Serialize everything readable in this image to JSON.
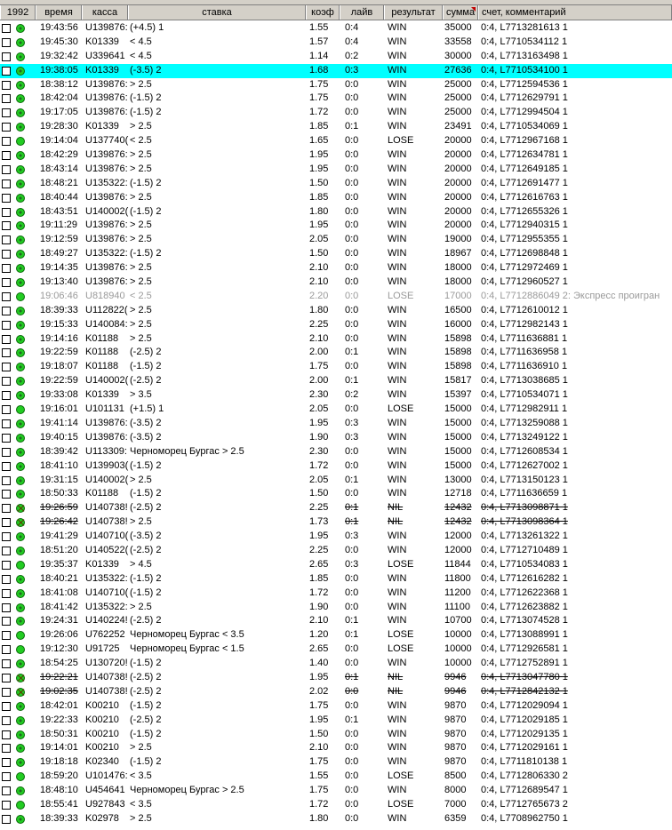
{
  "header": {
    "count": "1992",
    "time": "время",
    "kassa": "касса",
    "bet": "ставка",
    "coef": "коэф",
    "live": "лайв",
    "result": "результат",
    "sum": "сумма",
    "comment": "счет, комментарий"
  },
  "rows": [
    {
      "time": "19:43:56",
      "kassa": "U139876:",
      "bet": "(+4.5) 1",
      "coef": "1.55",
      "live": "0:4",
      "result": "WIN",
      "sum": "35000",
      "comment": "0:4, L7713281613 1",
      "state": "normal",
      "icon": "mixed"
    },
    {
      "time": "19:45:30",
      "kassa": "K01339",
      "bet": "< 4.5",
      "coef": "1.57",
      "live": "0:4",
      "result": "WIN",
      "sum": "33558",
      "comment": "0:4, L7710534112 1",
      "state": "normal",
      "icon": "mixed"
    },
    {
      "time": "19:32:42",
      "kassa": "U339641",
      "bet": "< 4.5",
      "coef": "1.14",
      "live": "0:2",
      "result": "WIN",
      "sum": "30000",
      "comment": "0:4, L7713163498 1",
      "state": "normal",
      "icon": "mixed"
    },
    {
      "time": "19:38:05",
      "kassa": "K01339",
      "bet": "(-3.5) 2",
      "coef": "1.68",
      "live": "0:3",
      "result": "WIN",
      "sum": "27636",
      "comment": "0:4, L7710534100 1",
      "state": "selected",
      "icon": "mixed"
    },
    {
      "time": "18:38:12",
      "kassa": "U139876:",
      "bet": "> 2.5",
      "coef": "1.75",
      "live": "0:0",
      "result": "WIN",
      "sum": "25000",
      "comment": "0:4, L7712594536 1",
      "state": "normal",
      "icon": "mixed"
    },
    {
      "time": "18:42:04",
      "kassa": "U139876:",
      "bet": "(-1.5) 2",
      "coef": "1.75",
      "live": "0:0",
      "result": "WIN",
      "sum": "25000",
      "comment": "0:4, L7712629791 1",
      "state": "normal",
      "icon": "mixed"
    },
    {
      "time": "19:17:05",
      "kassa": "U139876:",
      "bet": "(-1.5) 2",
      "coef": "1.72",
      "live": "0:0",
      "result": "WIN",
      "sum": "25000",
      "comment": "0:4, L7712994504 1",
      "state": "normal",
      "icon": "mixed"
    },
    {
      "time": "19:28:30",
      "kassa": "K01339",
      "bet": "> 2.5",
      "coef": "1.85",
      "live": "0:1",
      "result": "WIN",
      "sum": "23491",
      "comment": "0:4, L7710534069 1",
      "state": "normal",
      "icon": "mixed"
    },
    {
      "time": "19:14:04",
      "kassa": "U137740(",
      "bet": "< 2.5",
      "coef": "1.65",
      "live": "0:0",
      "result": "LOSE",
      "sum": "20000",
      "comment": "0:4, L7712967168 1",
      "state": "normal",
      "icon": "green"
    },
    {
      "time": "18:42:29",
      "kassa": "U139876:",
      "bet": "> 2.5",
      "coef": "1.95",
      "live": "0:0",
      "result": "WIN",
      "sum": "20000",
      "comment": "0:4, L7712634781 1",
      "state": "normal",
      "icon": "mixed"
    },
    {
      "time": "18:43:14",
      "kassa": "U139876:",
      "bet": "> 2.5",
      "coef": "1.95",
      "live": "0:0",
      "result": "WIN",
      "sum": "20000",
      "comment": "0:4, L7712649185 1",
      "state": "normal",
      "icon": "mixed"
    },
    {
      "time": "18:48:21",
      "kassa": "U135322:",
      "bet": "(-1.5) 2",
      "coef": "1.50",
      "live": "0:0",
      "result": "WIN",
      "sum": "20000",
      "comment": "0:4, L7712691477 1",
      "state": "normal",
      "icon": "mixed"
    },
    {
      "time": "18:40:44",
      "kassa": "U139876:",
      "bet": "> 2.5",
      "coef": "1.85",
      "live": "0:0",
      "result": "WIN",
      "sum": "20000",
      "comment": "0:4, L7712616763 1",
      "state": "normal",
      "icon": "mixed"
    },
    {
      "time": "18:43:51",
      "kassa": "U140002(",
      "bet": "(-1.5) 2",
      "coef": "1.80",
      "live": "0:0",
      "result": "WIN",
      "sum": "20000",
      "comment": "0:4, L7712655326 1",
      "state": "normal",
      "icon": "mixed"
    },
    {
      "time": "19:11:29",
      "kassa": "U139876:",
      "bet": "> 2.5",
      "coef": "1.95",
      "live": "0:0",
      "result": "WIN",
      "sum": "20000",
      "comment": "0:4, L7712940315 1",
      "state": "normal",
      "icon": "mixed"
    },
    {
      "time": "19:12:59",
      "kassa": "U139876:",
      "bet": "> 2.5",
      "coef": "2.05",
      "live": "0:0",
      "result": "WIN",
      "sum": "19000",
      "comment": "0:4, L7712955355 1",
      "state": "normal",
      "icon": "mixed"
    },
    {
      "time": "18:49:27",
      "kassa": "U135322:",
      "bet": "(-1.5) 2",
      "coef": "1.50",
      "live": "0:0",
      "result": "WIN",
      "sum": "18967",
      "comment": "0:4, L7712698848 1",
      "state": "normal",
      "icon": "mixed"
    },
    {
      "time": "19:14:35",
      "kassa": "U139876:",
      "bet": "> 2.5",
      "coef": "2.10",
      "live": "0:0",
      "result": "WIN",
      "sum": "18000",
      "comment": "0:4, L7712972469 1",
      "state": "normal",
      "icon": "mixed"
    },
    {
      "time": "19:13:40",
      "kassa": "U139876:",
      "bet": "> 2.5",
      "coef": "2.10",
      "live": "0:0",
      "result": "WIN",
      "sum": "18000",
      "comment": "0:4, L7712960527 1",
      "state": "normal",
      "icon": "mixed"
    },
    {
      "time": "19:06:46",
      "kassa": "U818940",
      "bet": "< 2.5",
      "coef": "2.20",
      "live": "0:0",
      "result": "LOSE",
      "sum": "17000",
      "comment": "0:4, L7712886049 2: Экспресс проигран",
      "state": "gray",
      "icon": "green"
    },
    {
      "time": "18:39:33",
      "kassa": "U112822(",
      "bet": "> 2.5",
      "coef": "1.80",
      "live": "0:0",
      "result": "WIN",
      "sum": "16500",
      "comment": "0:4, L7712610012 1",
      "state": "normal",
      "icon": "mixed"
    },
    {
      "time": "19:15:33",
      "kassa": "U140084:",
      "bet": "> 2.5",
      "coef": "2.25",
      "live": "0:0",
      "result": "WIN",
      "sum": "16000",
      "comment": "0:4, L7712982143 1",
      "state": "normal",
      "icon": "mixed"
    },
    {
      "time": "19:14:16",
      "kassa": "K01188",
      "bet": "> 2.5",
      "coef": "2.10",
      "live": "0:0",
      "result": "WIN",
      "sum": "15898",
      "comment": "0:4, L7711636881 1",
      "state": "normal",
      "icon": "mixed"
    },
    {
      "time": "19:22:59",
      "kassa": "K01188",
      "bet": "(-2.5) 2",
      "coef": "2.00",
      "live": "0:1",
      "result": "WIN",
      "sum": "15898",
      "comment": "0:4, L7711636958 1",
      "state": "normal",
      "icon": "mixed"
    },
    {
      "time": "19:18:07",
      "kassa": "K01188",
      "bet": "(-1.5) 2",
      "coef": "1.75",
      "live": "0:0",
      "result": "WIN",
      "sum": "15898",
      "comment": "0:4, L7711636910 1",
      "state": "normal",
      "icon": "mixed"
    },
    {
      "time": "19:22:59",
      "kassa": "U140002(",
      "bet": "(-2.5) 2",
      "coef": "2.00",
      "live": "0:1",
      "result": "WIN",
      "sum": "15817",
      "comment": "0:4, L7713038685 1",
      "state": "normal",
      "icon": "mixed"
    },
    {
      "time": "19:33:08",
      "kassa": "K01339",
      "bet": "> 3.5",
      "coef": "2.30",
      "live": "0:2",
      "result": "WIN",
      "sum": "15397",
      "comment": "0:4, L7710534071 1",
      "state": "normal",
      "icon": "mixed"
    },
    {
      "time": "19:16:01",
      "kassa": "U101131",
      "bet": "(+1.5) 1",
      "coef": "2.05",
      "live": "0:0",
      "result": "LOSE",
      "sum": "15000",
      "comment": "0:4, L7712982911 1",
      "state": "normal",
      "icon": "green"
    },
    {
      "time": "19:41:14",
      "kassa": "U139876:",
      "bet": "(-3.5) 2",
      "coef": "1.95",
      "live": "0:3",
      "result": "WIN",
      "sum": "15000",
      "comment": "0:4, L7713259088 1",
      "state": "normal",
      "icon": "mixed"
    },
    {
      "time": "19:40:15",
      "kassa": "U139876:",
      "bet": "(-3.5) 2",
      "coef": "1.90",
      "live": "0:3",
      "result": "WIN",
      "sum": "15000",
      "comment": "0:4, L7713249122 1",
      "state": "normal",
      "icon": "mixed"
    },
    {
      "time": "18:39:42",
      "kassa": "U113309:",
      "bet": "Черноморец Бургас > 2.5",
      "coef": "2.30",
      "live": "0:0",
      "result": "WIN",
      "sum": "15000",
      "comment": "0:4, L7712608534 1",
      "state": "normal",
      "icon": "mixed"
    },
    {
      "time": "18:41:10",
      "kassa": "U139903(",
      "bet": "(-1.5) 2",
      "coef": "1.72",
      "live": "0:0",
      "result": "WIN",
      "sum": "15000",
      "comment": "0:4, L7712627002 1",
      "state": "normal",
      "icon": "mixed"
    },
    {
      "time": "19:31:15",
      "kassa": "U140002(",
      "bet": "> 2.5",
      "coef": "2.05",
      "live": "0:1",
      "result": "WIN",
      "sum": "13000",
      "comment": "0:4, L7713150123 1",
      "state": "normal",
      "icon": "mixed"
    },
    {
      "time": "18:50:33",
      "kassa": "K01188",
      "bet": "(-1.5) 2",
      "coef": "1.50",
      "live": "0:0",
      "result": "WIN",
      "sum": "12718",
      "comment": "0:4, L7711636659 1",
      "state": "normal",
      "icon": "mixed"
    },
    {
      "time": "19:26:59",
      "kassa": "U140738!",
      "bet": "(-2.5) 2",
      "coef": "2.25",
      "live": "0:1",
      "result": "NIL",
      "sum": "12432",
      "comment": "0:4, L7713098871 1",
      "state": "nil",
      "icon": "x"
    },
    {
      "time": "19:26:42",
      "kassa": "U140738!",
      "bet": "> 2.5",
      "coef": "1.73",
      "live": "0:1",
      "result": "NIL",
      "sum": "12432",
      "comment": "0:4, L7713098364 1",
      "state": "nil",
      "icon": "x"
    },
    {
      "time": "19:41:29",
      "kassa": "U140710(",
      "bet": "(-3.5) 2",
      "coef": "1.95",
      "live": "0:3",
      "result": "WIN",
      "sum": "12000",
      "comment": "0:4, L7713261322 1",
      "state": "normal",
      "icon": "mixed"
    },
    {
      "time": "18:51:20",
      "kassa": "U140522(",
      "bet": "(-2.5) 2",
      "coef": "2.25",
      "live": "0:0",
      "result": "WIN",
      "sum": "12000",
      "comment": "0:4, L7712710489 1",
      "state": "normal",
      "icon": "mixed"
    },
    {
      "time": "19:35:37",
      "kassa": "K01339",
      "bet": "> 4.5",
      "coef": "2.65",
      "live": "0:3",
      "result": "LOSE",
      "sum": "11844",
      "comment": "0:4, L7710534083 1",
      "state": "normal",
      "icon": "green"
    },
    {
      "time": "18:40:21",
      "kassa": "U135322:",
      "bet": "(-1.5) 2",
      "coef": "1.85",
      "live": "0:0",
      "result": "WIN",
      "sum": "11800",
      "comment": "0:4, L7712616282 1",
      "state": "normal",
      "icon": "mixed"
    },
    {
      "time": "18:41:08",
      "kassa": "U140710(",
      "bet": "(-1.5) 2",
      "coef": "1.72",
      "live": "0:0",
      "result": "WIN",
      "sum": "11200",
      "comment": "0:4, L7712622368 1",
      "state": "normal",
      "icon": "mixed"
    },
    {
      "time": "18:41:42",
      "kassa": "U135322:",
      "bet": "> 2.5",
      "coef": "1.90",
      "live": "0:0",
      "result": "WIN",
      "sum": "11100",
      "comment": "0:4, L7712623882 1",
      "state": "normal",
      "icon": "mixed"
    },
    {
      "time": "19:24:31",
      "kassa": "U140224!",
      "bet": "(-2.5) 2",
      "coef": "2.10",
      "live": "0:1",
      "result": "WIN",
      "sum": "10700",
      "comment": "0:4, L7713074528 1",
      "state": "normal",
      "icon": "mixed"
    },
    {
      "time": "19:26:06",
      "kassa": "U762252",
      "bet": "Черноморец Бургас < 3.5",
      "coef": "1.20",
      "live": "0:1",
      "result": "LOSE",
      "sum": "10000",
      "comment": "0:4, L7713088991 1",
      "state": "normal",
      "icon": "green"
    },
    {
      "time": "19:12:30",
      "kassa": "U91725",
      "bet": "Черноморец Бургас < 1.5",
      "coef": "2.65",
      "live": "0:0",
      "result": "LOSE",
      "sum": "10000",
      "comment": "0:4, L7712926581 1",
      "state": "normal",
      "icon": "green"
    },
    {
      "time": "18:54:25",
      "kassa": "U130720!",
      "bet": "(-1.5) 2",
      "coef": "1.40",
      "live": "0:0",
      "result": "WIN",
      "sum": "10000",
      "comment": "0:4, L7712752891 1",
      "state": "normal",
      "icon": "mixed"
    },
    {
      "time": "19:22:21",
      "kassa": "U140738!",
      "bet": "(-2.5) 2",
      "coef": "1.95",
      "live": "0:1",
      "result": "NIL",
      "sum": "9946",
      "comment": "0:4, L7713047780 1",
      "state": "nil",
      "icon": "x"
    },
    {
      "time": "19:02:35",
      "kassa": "U140738!",
      "bet": "(-2.5) 2",
      "coef": "2.02",
      "live": "0:0",
      "result": "NIL",
      "sum": "9946",
      "comment": "0:4, L7712842132 1",
      "state": "nil",
      "icon": "x"
    },
    {
      "time": "18:42:01",
      "kassa": "K00210",
      "bet": "(-1.5) 2",
      "coef": "1.75",
      "live": "0:0",
      "result": "WIN",
      "sum": "9870",
      "comment": "0:4, L7712029094 1",
      "state": "normal",
      "icon": "mixed"
    },
    {
      "time": "19:22:33",
      "kassa": "K00210",
      "bet": "(-2.5) 2",
      "coef": "1.95",
      "live": "0:1",
      "result": "WIN",
      "sum": "9870",
      "comment": "0:4, L7712029185 1",
      "state": "normal",
      "icon": "mixed"
    },
    {
      "time": "18:50:31",
      "kassa": "K00210",
      "bet": "(-1.5) 2",
      "coef": "1.50",
      "live": "0:0",
      "result": "WIN",
      "sum": "9870",
      "comment": "0:4, L7712029135 1",
      "state": "normal",
      "icon": "mixed"
    },
    {
      "time": "19:14:01",
      "kassa": "K00210",
      "bet": "> 2.5",
      "coef": "2.10",
      "live": "0:0",
      "result": "WIN",
      "sum": "9870",
      "comment": "0:4, L7712029161 1",
      "state": "normal",
      "icon": "mixed"
    },
    {
      "time": "19:18:18",
      "kassa": "K02340",
      "bet": "(-1.5) 2",
      "coef": "1.75",
      "live": "0:0",
      "result": "WIN",
      "sum": "9870",
      "comment": "0:4, L7711810138 1",
      "state": "normal",
      "icon": "mixed"
    },
    {
      "time": "18:59:20",
      "kassa": "U101476:",
      "bet": "< 3.5",
      "coef": "1.55",
      "live": "0:0",
      "result": "LOSE",
      "sum": "8500",
      "comment": "0:4, L7712806330 2",
      "state": "normal",
      "icon": "green"
    },
    {
      "time": "18:48:10",
      "kassa": "U454641",
      "bet": "Черноморец Бургас > 2.5",
      "coef": "1.75",
      "live": "0:0",
      "result": "WIN",
      "sum": "8000",
      "comment": "0:4, L7712689547 1",
      "state": "normal",
      "icon": "mixed"
    },
    {
      "time": "18:55:41",
      "kassa": "U927843",
      "bet": "< 3.5",
      "coef": "1.72",
      "live": "0:0",
      "result": "LOSE",
      "sum": "7000",
      "comment": "0:4, L7712765673 2",
      "state": "normal",
      "icon": "green"
    },
    {
      "time": "18:39:33",
      "kassa": "K02978",
      "bet": "> 2.5",
      "coef": "1.80",
      "live": "0:0",
      "result": "WIN",
      "sum": "6359",
      "comment": "0:4, L7708962750 1",
      "state": "normal",
      "icon": "mixed"
    }
  ]
}
